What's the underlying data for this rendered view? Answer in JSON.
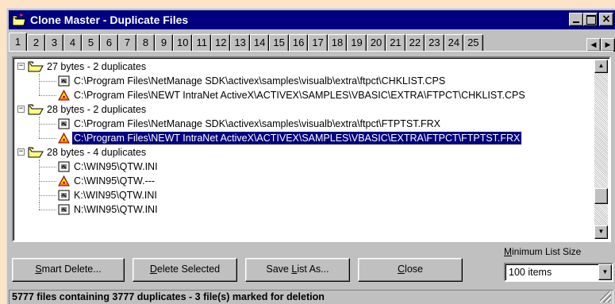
{
  "window": {
    "title": "Clone Master - Duplicate Files",
    "colors": {
      "title_bar": "#000080",
      "face": "#c0c0c0",
      "selection": "#000080",
      "desktop": "#fce4c8"
    }
  },
  "title_buttons": {
    "minimize_icon": "minimize-icon",
    "maximize_icon": "maximize-icon",
    "close": "×"
  },
  "tabs": [
    "1",
    "2",
    "3",
    "4",
    "5",
    "6",
    "7",
    "8",
    "9",
    "10",
    "11",
    "12",
    "13",
    "14",
    "15",
    "16",
    "17",
    "18",
    "19",
    "20",
    "21",
    "22",
    "23",
    "24",
    "25"
  ],
  "active_tab": "1",
  "tab_scroll": {
    "left": "◀",
    "right": "▶"
  },
  "tree": {
    "rows": [
      {
        "kind": "group",
        "label": "27 bytes - 2 duplicates",
        "expander": "−",
        "icon": "open-folder-icon"
      },
      {
        "kind": "file",
        "label": "C:\\Program Files\\NetManage SDK\\activex\\samples\\visualb\\extra\\ftpct\\CHKLIST.CPS",
        "icon": "document-icon"
      },
      {
        "kind": "file",
        "label": "C:\\Program Files\\NEWT IntraNet ActiveX\\ACTIVEX\\SAMPLES\\VBASIC\\EXTRA\\FTPCT\\CHKLIST.CPS",
        "icon": "marked-delete-icon",
        "last": true
      },
      {
        "kind": "group",
        "label": "28 bytes - 2 duplicates",
        "expander": "−",
        "icon": "open-folder-icon"
      },
      {
        "kind": "file",
        "label": "C:\\Program Files\\NetManage SDK\\activex\\samples\\visualb\\extra\\ftpct\\FTPTST.FRX",
        "icon": "document-icon"
      },
      {
        "kind": "file",
        "label": "C:\\Program Files\\NEWT IntraNet ActiveX\\ACTIVEX\\SAMPLES\\VBASIC\\EXTRA\\FTPCT\\FTPTST.FRX",
        "icon": "marked-delete-icon",
        "selected": true,
        "last": true
      },
      {
        "kind": "group",
        "label": "28 bytes - 4 duplicates",
        "expander": "−",
        "icon": "open-folder-icon"
      },
      {
        "kind": "file",
        "label": "C:\\WIN95\\QTW.INI",
        "icon": "document-icon"
      },
      {
        "kind": "file",
        "label": "C:\\WIN95\\QTW.---",
        "icon": "marked-delete-icon"
      },
      {
        "kind": "file",
        "label": "K:\\WIN95\\QTW.INI",
        "icon": "document-icon"
      },
      {
        "kind": "file",
        "label": "N:\\WIN95\\QTW.INI",
        "icon": "document-icon",
        "last": true
      }
    ]
  },
  "scrollbar": {
    "up": "▲",
    "down": "▼"
  },
  "buttons": {
    "smart_delete": {
      "accel": "S",
      "rest": "mart Delete..."
    },
    "delete_selected": {
      "accel": "D",
      "rest": "elete Selected"
    },
    "save_list": {
      "pre": "Save ",
      "accel": "L",
      "rest": "ist As..."
    },
    "close": {
      "accel": "C",
      "rest": "lose"
    }
  },
  "min_list_size": {
    "caption_accel": "M",
    "caption_rest": "inimum List Size",
    "value": "100 items",
    "arrow": "▼"
  },
  "status": "5777 files containing 3777 duplicates - 3 file(s) marked for deletion"
}
